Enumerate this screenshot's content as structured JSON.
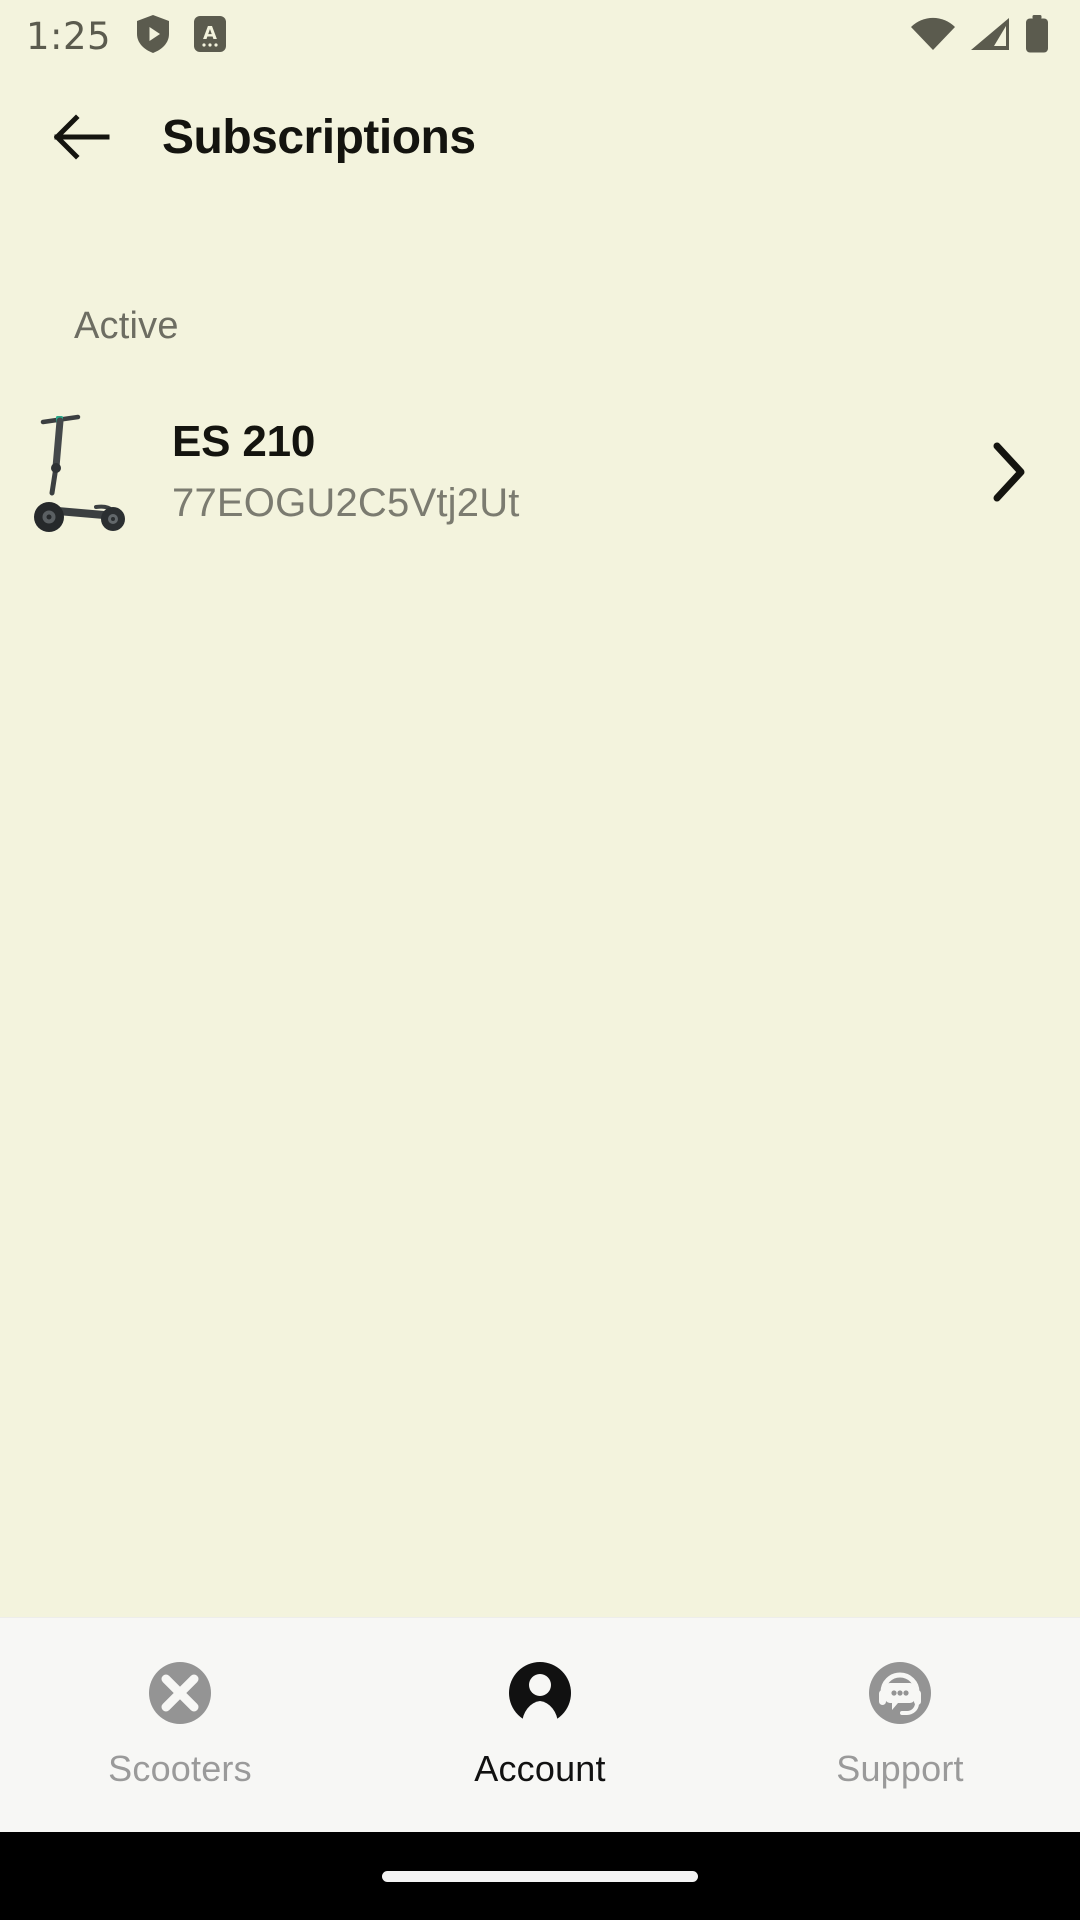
{
  "status_bar": {
    "time": "1:25",
    "left_icons": [
      "shield-play-icon",
      "android-a-badge-icon"
    ],
    "right_icons": [
      "wifi-icon",
      "cellular-signal-icon",
      "battery-full-icon"
    ],
    "text_color": "#5b5b4e"
  },
  "app_bar": {
    "back_icon": "arrow-left-icon",
    "title": "Subscriptions"
  },
  "content": {
    "section_label": "Active",
    "subscriptions": [
      {
        "thumb": "electric-scooter-image",
        "name": "ES 210",
        "serial": "77EOGU2C5Vtj2Ut",
        "chevron": "chevron-right-icon"
      }
    ]
  },
  "bottom_nav": {
    "items": [
      {
        "label": "Scooters",
        "icon": "scooter-brand-circle-x-icon",
        "active": false
      },
      {
        "label": "Account",
        "icon": "person-avatar-icon",
        "active": true
      },
      {
        "label": "Support",
        "icon": "headset-support-icon",
        "active": false
      }
    ]
  },
  "colors": {
    "background": "#f3f3dd",
    "nav_background": "#f7f7f5",
    "primary_text": "#14140f",
    "secondary_text": "#7b7b70",
    "inactive_nav": "#9a9a9a",
    "gesture_bar": "#000000"
  }
}
